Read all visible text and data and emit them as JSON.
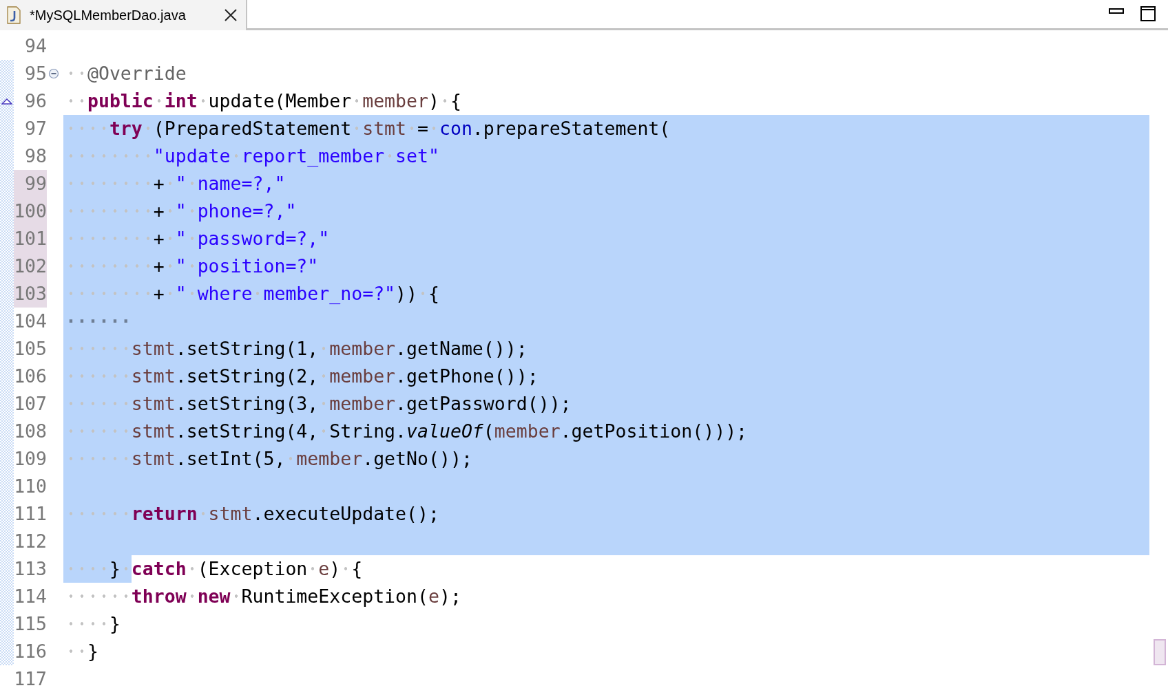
{
  "tab": {
    "title": "*MySQLMemberDao.java"
  },
  "lines": [
    {
      "number": "94",
      "selected": false,
      "changed": false,
      "in_range": false
    },
    {
      "number": "95",
      "selected": false,
      "changed": false,
      "in_range": true,
      "fold_expanded": true,
      "tokens": [
        {
          "kind": "annotation",
          "text": "  @Override"
        }
      ]
    },
    {
      "number": "96",
      "selected": false,
      "changed": false,
      "in_range": true,
      "override": true,
      "tokens": [
        {
          "kind": "keyword",
          "text": "  public"
        },
        {
          "kind": "keyword",
          "text": " int"
        },
        {
          "kind": "plain",
          "text": " update(Member "
        },
        {
          "kind": "local",
          "text": "member"
        },
        {
          "kind": "plain",
          "text": ") {"
        }
      ]
    },
    {
      "number": "97",
      "selected": true,
      "changed": false,
      "in_range": true,
      "tokens": [
        {
          "kind": "keyword",
          "text": "    try"
        },
        {
          "kind": "plain",
          "text": " (PreparedStatement "
        },
        {
          "kind": "local",
          "text": "stmt"
        },
        {
          "kind": "plain",
          "text": " = "
        },
        {
          "kind": "field",
          "text": "con"
        },
        {
          "kind": "plain",
          "text": ".prepareStatement("
        }
      ]
    },
    {
      "number": "98",
      "selected": true,
      "changed": false,
      "in_range": true,
      "tokens": [
        {
          "kind": "string",
          "text": "        \"update report_member set\""
        }
      ]
    },
    {
      "number": "99",
      "selected": true,
      "changed": true,
      "in_range": true,
      "tokens": [
        {
          "kind": "plain",
          "text": "        + "
        },
        {
          "kind": "string",
          "text": "\" name=?,\""
        }
      ]
    },
    {
      "number": "100",
      "selected": true,
      "changed": true,
      "in_range": true,
      "tokens": [
        {
          "kind": "plain",
          "text": "        + "
        },
        {
          "kind": "string",
          "text": "\" phone=?,\""
        }
      ]
    },
    {
      "number": "101",
      "selected": true,
      "changed": true,
      "in_range": true,
      "tokens": [
        {
          "kind": "plain",
          "text": "        + "
        },
        {
          "kind": "string",
          "text": "\" password=?,\""
        }
      ]
    },
    {
      "number": "102",
      "selected": true,
      "changed": true,
      "in_range": true,
      "tokens": [
        {
          "kind": "plain",
          "text": "        + "
        },
        {
          "kind": "string",
          "text": "\" position=?\""
        }
      ]
    },
    {
      "number": "103",
      "selected": true,
      "changed": true,
      "in_range": true,
      "tokens": [
        {
          "kind": "plain",
          "text": "        + "
        },
        {
          "kind": "string",
          "text": "\" where member_no=?\""
        },
        {
          "kind": "plain",
          "text": ")) {"
        }
      ]
    },
    {
      "number": "104",
      "selected": true,
      "changed": false,
      "in_range": true,
      "tokens": [
        {
          "kind": "whitespace",
          "text": "······"
        }
      ]
    },
    {
      "number": "105",
      "selected": true,
      "changed": false,
      "in_range": true,
      "tokens": [
        {
          "kind": "local",
          "text": "      stmt"
        },
        {
          "kind": "plain",
          "text": ".setString(1, "
        },
        {
          "kind": "local",
          "text": "member"
        },
        {
          "kind": "plain",
          "text": ".getName());"
        }
      ]
    },
    {
      "number": "106",
      "selected": true,
      "changed": false,
      "in_range": true,
      "tokens": [
        {
          "kind": "local",
          "text": "      stmt"
        },
        {
          "kind": "plain",
          "text": ".setString(2, "
        },
        {
          "kind": "local",
          "text": "member"
        },
        {
          "kind": "plain",
          "text": ".getPhone());"
        }
      ]
    },
    {
      "number": "107",
      "selected": true,
      "changed": false,
      "in_range": true,
      "tokens": [
        {
          "kind": "local",
          "text": "      stmt"
        },
        {
          "kind": "plain",
          "text": ".setString(3, "
        },
        {
          "kind": "local",
          "text": "member"
        },
        {
          "kind": "plain",
          "text": ".getPassword());"
        }
      ]
    },
    {
      "number": "108",
      "selected": true,
      "changed": false,
      "in_range": true,
      "tokens": [
        {
          "kind": "local",
          "text": "      stmt"
        },
        {
          "kind": "plain",
          "text": ".setString(4, String."
        },
        {
          "kind": "static",
          "text": "valueOf"
        },
        {
          "kind": "plain",
          "text": "("
        },
        {
          "kind": "local",
          "text": "member"
        },
        {
          "kind": "plain",
          "text": ".getPosition()));"
        }
      ]
    },
    {
      "number": "109",
      "selected": true,
      "changed": false,
      "in_range": true,
      "tokens": [
        {
          "kind": "local",
          "text": "      stmt"
        },
        {
          "kind": "plain",
          "text": ".setInt(5, "
        },
        {
          "kind": "local",
          "text": "member"
        },
        {
          "kind": "plain",
          "text": ".getNo());"
        }
      ]
    },
    {
      "number": "110",
      "selected": true,
      "changed": false,
      "in_range": true
    },
    {
      "number": "111",
      "selected": true,
      "changed": false,
      "in_range": true,
      "tokens": [
        {
          "kind": "keyword",
          "text": "      return"
        },
        {
          "kind": "local",
          "text": " stmt"
        },
        {
          "kind": "plain",
          "text": ".executeUpdate();"
        }
      ]
    },
    {
      "number": "112",
      "selected": true,
      "changed": false,
      "in_range": true
    },
    {
      "number": "113",
      "selected": false,
      "changed": false,
      "in_range": true,
      "tokens": [
        {
          "kind": "plain",
          "text": "    } ",
          "selected": true
        },
        {
          "kind": "keyword",
          "text": "catch"
        },
        {
          "kind": "plain",
          "text": " (Exception "
        },
        {
          "kind": "local",
          "text": "e"
        },
        {
          "kind": "plain",
          "text": ") {"
        }
      ]
    },
    {
      "number": "114",
      "selected": false,
      "changed": false,
      "in_range": true,
      "tokens": [
        {
          "kind": "keyword",
          "text": "      throw"
        },
        {
          "kind": "keyword",
          "text": " new"
        },
        {
          "kind": "plain",
          "text": " RuntimeException("
        },
        {
          "kind": "local",
          "text": "e"
        },
        {
          "kind": "plain",
          "text": ");"
        }
      ]
    },
    {
      "number": "115",
      "selected": false,
      "changed": false,
      "in_range": true,
      "tokens": [
        {
          "kind": "plain",
          "text": "    }"
        }
      ]
    },
    {
      "number": "116",
      "selected": false,
      "changed": false,
      "in_range": true,
      "tokens": [
        {
          "kind": "plain",
          "text": "  }"
        }
      ]
    },
    {
      "number": "117",
      "selected": false,
      "changed": false,
      "in_range": false
    }
  ]
}
